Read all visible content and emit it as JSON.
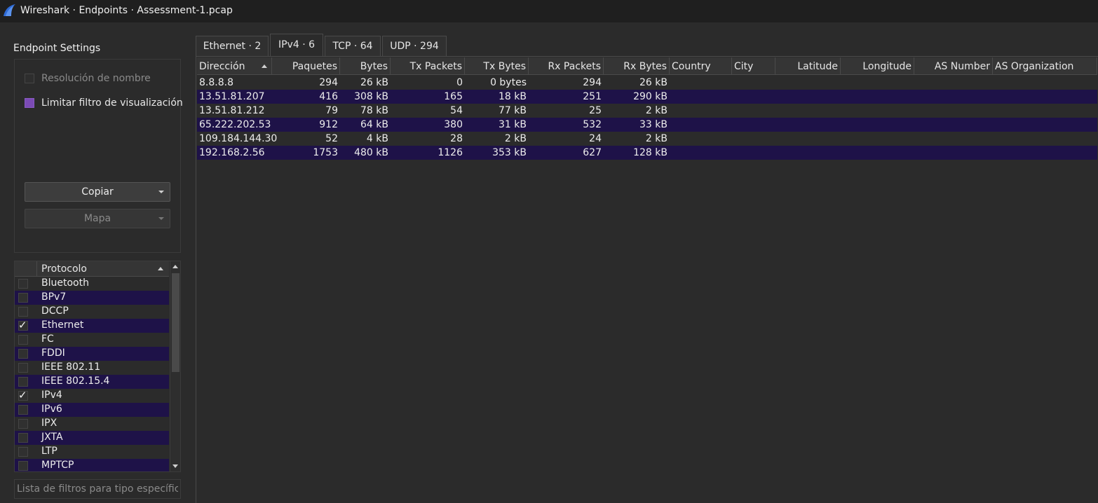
{
  "window": {
    "title": "Wireshark · Endpoints · Assessment-1.pcap"
  },
  "settings": {
    "label": "Endpoint Settings",
    "name_resolution_label": "Resolución de nombre",
    "name_resolution_checked": false,
    "name_resolution_enabled": false,
    "limit_display_filter_label": "Limitar filtro de visualización",
    "limit_display_filter_checked": true,
    "copy_button_label": "Copiar",
    "map_button_label": "Mapa",
    "map_button_enabled": false
  },
  "protocols": {
    "header": "Protocolo",
    "items": [
      {
        "name": "Bluetooth",
        "checked": false
      },
      {
        "name": "BPv7",
        "checked": false
      },
      {
        "name": "DCCP",
        "checked": false
      },
      {
        "name": "Ethernet",
        "checked": true
      },
      {
        "name": "FC",
        "checked": false
      },
      {
        "name": "FDDI",
        "checked": false
      },
      {
        "name": "IEEE 802.11",
        "checked": false
      },
      {
        "name": "IEEE 802.15.4",
        "checked": false
      },
      {
        "name": "IPv4",
        "checked": true
      },
      {
        "name": "IPv6",
        "checked": false
      },
      {
        "name": "IPX",
        "checked": false
      },
      {
        "name": "JXTA",
        "checked": false
      },
      {
        "name": "LTP",
        "checked": false
      },
      {
        "name": "MPTCP",
        "checked": false
      }
    ],
    "filter_placeholder": "Lista de filtros para tipo específico"
  },
  "tabs": [
    {
      "label": "Ethernet · 2",
      "active": false
    },
    {
      "label": "IPv4 · 6",
      "active": true
    },
    {
      "label": "TCP · 64",
      "active": false
    },
    {
      "label": "UDP · 294",
      "active": false
    }
  ],
  "table": {
    "columns": [
      "Dirección",
      "Paquetes",
      "Bytes",
      "Tx Packets",
      "Tx Bytes",
      "Rx Packets",
      "Rx Bytes",
      "Country",
      "City",
      "Latitude",
      "Longitude",
      "AS Number",
      "AS Organization"
    ],
    "sorted_column": "Dirección",
    "sort_order": "ascending",
    "rows": [
      [
        "8.8.8.8",
        "294",
        "26 kB",
        "0",
        "0 bytes",
        "294",
        "26 kB",
        "",
        "",
        "",
        "",
        "",
        ""
      ],
      [
        "13.51.81.207",
        "416",
        "308 kB",
        "165",
        "18 kB",
        "251",
        "290 kB",
        "",
        "",
        "",
        "",
        "",
        ""
      ],
      [
        "13.51.81.212",
        "79",
        "78 kB",
        "54",
        "77 kB",
        "25",
        "2 kB",
        "",
        "",
        "",
        "",
        "",
        ""
      ],
      [
        "65.222.202.53",
        "912",
        "64 kB",
        "380",
        "31 kB",
        "532",
        "33 kB",
        "",
        "",
        "",
        "",
        "",
        ""
      ],
      [
        "109.184.144.30",
        "52",
        "4 kB",
        "28",
        "2 kB",
        "24",
        "2 kB",
        "",
        "",
        "",
        "",
        "",
        ""
      ],
      [
        "192.168.2.56",
        "1753",
        "480 kB",
        "1126",
        "353 kB",
        "627",
        "128 kB",
        "",
        "",
        "",
        "",
        "",
        ""
      ]
    ]
  },
  "colors": {
    "background": "#2b2b2b",
    "alternate_row": "#1e1248",
    "checkbox_accent": "#7b4bb5",
    "app_icon": "#2f6bd6"
  }
}
